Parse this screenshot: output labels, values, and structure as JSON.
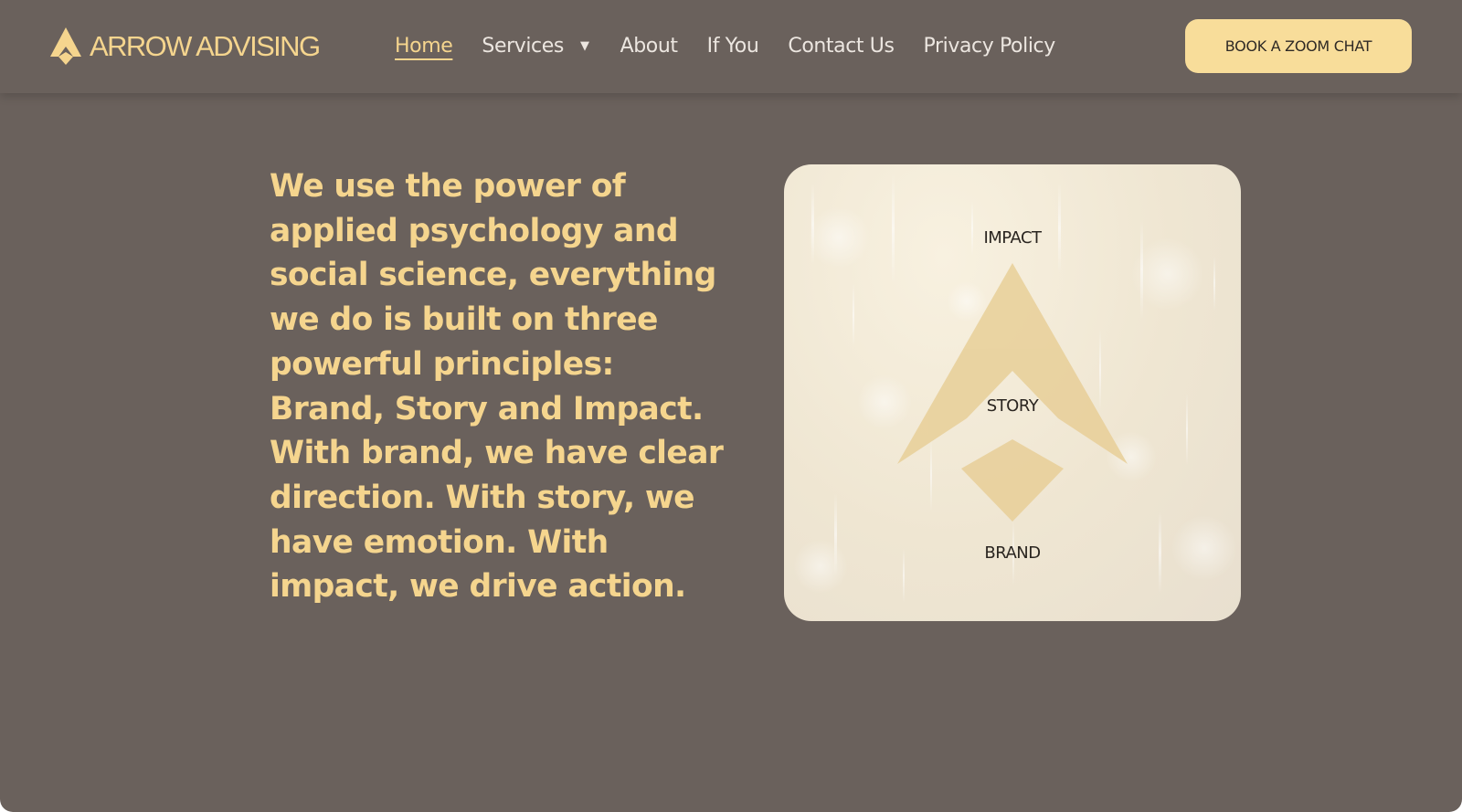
{
  "header": {
    "logo_text": "ARROW ADVISING",
    "logo_icon": "arrow-logo-icon",
    "nav": {
      "home": "Home",
      "services": "Services",
      "services_caret": "▼",
      "about": "About",
      "if_you": "If You",
      "contact": "Contact Us",
      "privacy": "Privacy Policy"
    },
    "cta_label": "BOOK A ZOOM CHAT"
  },
  "main": {
    "body_text": "We use the power of applied psychology and social science, everything we do is built on three powerful principles: Brand, Story and Impact. With brand, we have clear direction. With story, we have emotion. With impact, we drive action."
  },
  "diagram": {
    "top_label": "IMPACT",
    "middle_label": "STORY",
    "bottom_label": "BRAND"
  },
  "colors": {
    "background": "#6a615c",
    "accent_gold": "#f5d58e",
    "cta_background": "#f8dd9a",
    "card_background": "#efe6d2",
    "diagram_shape": "#e8cf98"
  }
}
